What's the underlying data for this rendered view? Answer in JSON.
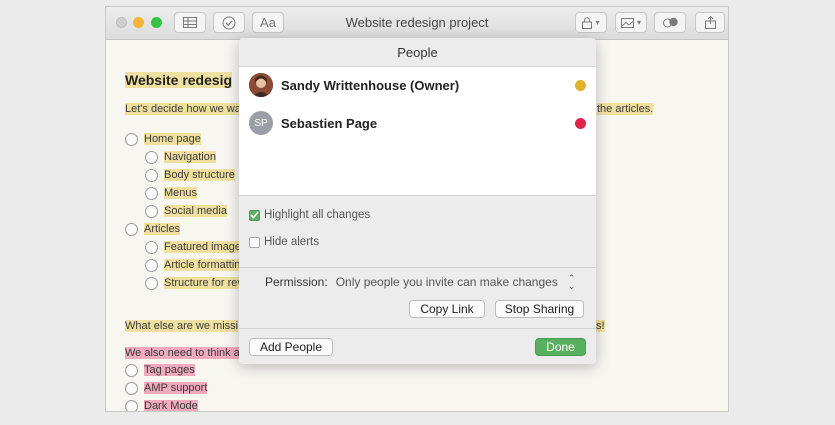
{
  "window": {
    "title": "Website redesign project",
    "toolbar": {
      "font_button": "Aa"
    }
  },
  "note": {
    "heading": "Website redesig",
    "intro_left": "Let's decide how we wa",
    "intro_right": "the articles.",
    "items": [
      {
        "label": "Home page",
        "level": 0
      },
      {
        "label": "Navigation",
        "level": 1
      },
      {
        "label": "Body structure",
        "level": 1
      },
      {
        "label": "Menus",
        "level": 1
      },
      {
        "label": "Social media",
        "level": 1
      },
      {
        "label": "Articles",
        "level": 0
      },
      {
        "label": "Featured image",
        "level": 1
      },
      {
        "label": "Article formattin",
        "level": 1
      },
      {
        "label": "Structure for rev",
        "level": 1
      }
    ],
    "question_left": "What else are we missi",
    "question_right": "s!",
    "also_left": "We also need to think a",
    "also_items": [
      "Tag pages",
      "AMP support",
      "Dark Mode"
    ]
  },
  "popover": {
    "title": "People",
    "people": [
      {
        "name": "Sandy Writtenhouse (Owner)",
        "initials": "",
        "color": "#e0b22b"
      },
      {
        "name": "Sebastien Page",
        "initials": "SP",
        "color": "#e0244c"
      }
    ],
    "highlight_changes": {
      "label": "Highlight all changes",
      "checked": true
    },
    "hide_alerts": {
      "label": "Hide alerts",
      "checked": false
    },
    "permission_label": "Permission:",
    "permission_value": "Only people you invite can make changes",
    "copy_link": "Copy Link",
    "stop_sharing": "Stop Sharing",
    "add_people": "Add People",
    "done": "Done"
  }
}
